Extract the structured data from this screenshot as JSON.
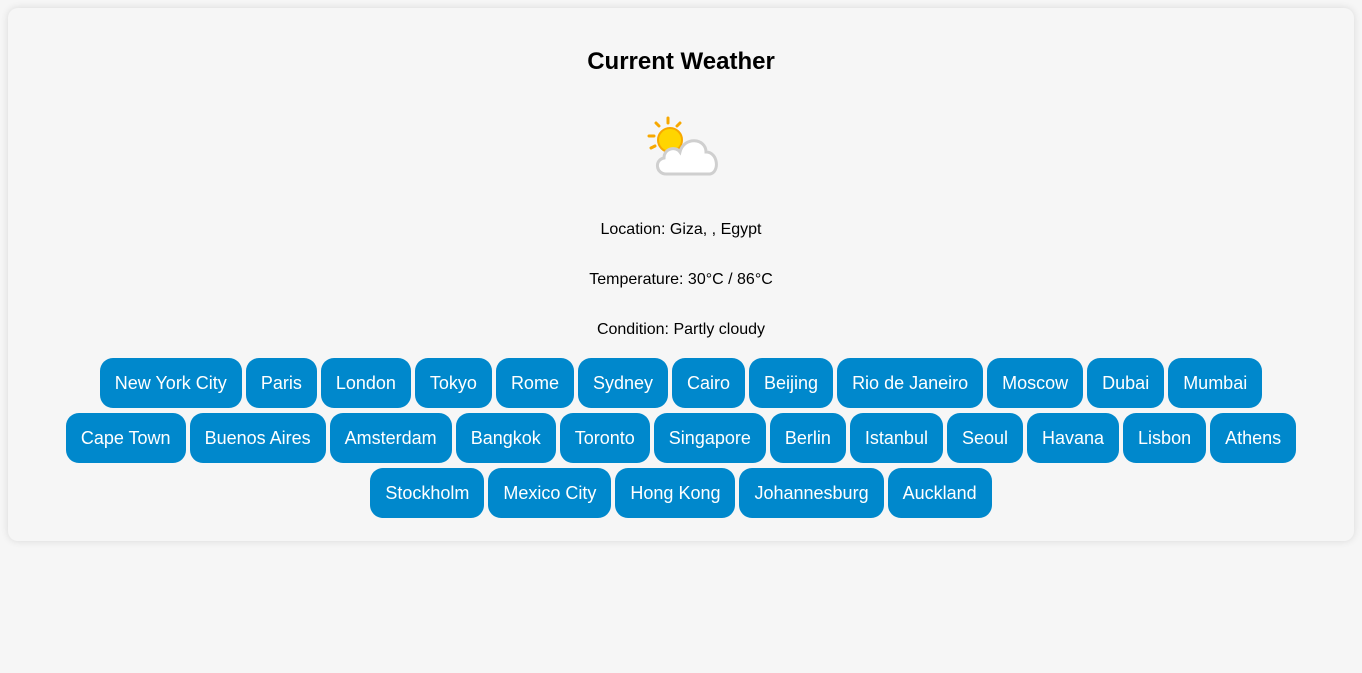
{
  "title": "Current Weather",
  "weather_icon": "partly-cloudy-icon",
  "location": "Location: Giza, , Egypt",
  "temperature": "Temperature: 30°C / 86°C",
  "condition": "Condition: Partly cloudy",
  "colors": {
    "button": "#0088cc",
    "button_text": "#ffffff",
    "background": "#f6f6f6"
  },
  "cities": [
    "New York City",
    "Paris",
    "London",
    "Tokyo",
    "Rome",
    "Sydney",
    "Cairo",
    "Beijing",
    "Rio de Janeiro",
    "Moscow",
    "Dubai",
    "Mumbai",
    "Cape Town",
    "Buenos Aires",
    "Amsterdam",
    "Bangkok",
    "Toronto",
    "Singapore",
    "Berlin",
    "Istanbul",
    "Seoul",
    "Havana",
    "Lisbon",
    "Athens",
    "Stockholm",
    "Mexico City",
    "Hong Kong",
    "Johannesburg",
    "Auckland"
  ]
}
